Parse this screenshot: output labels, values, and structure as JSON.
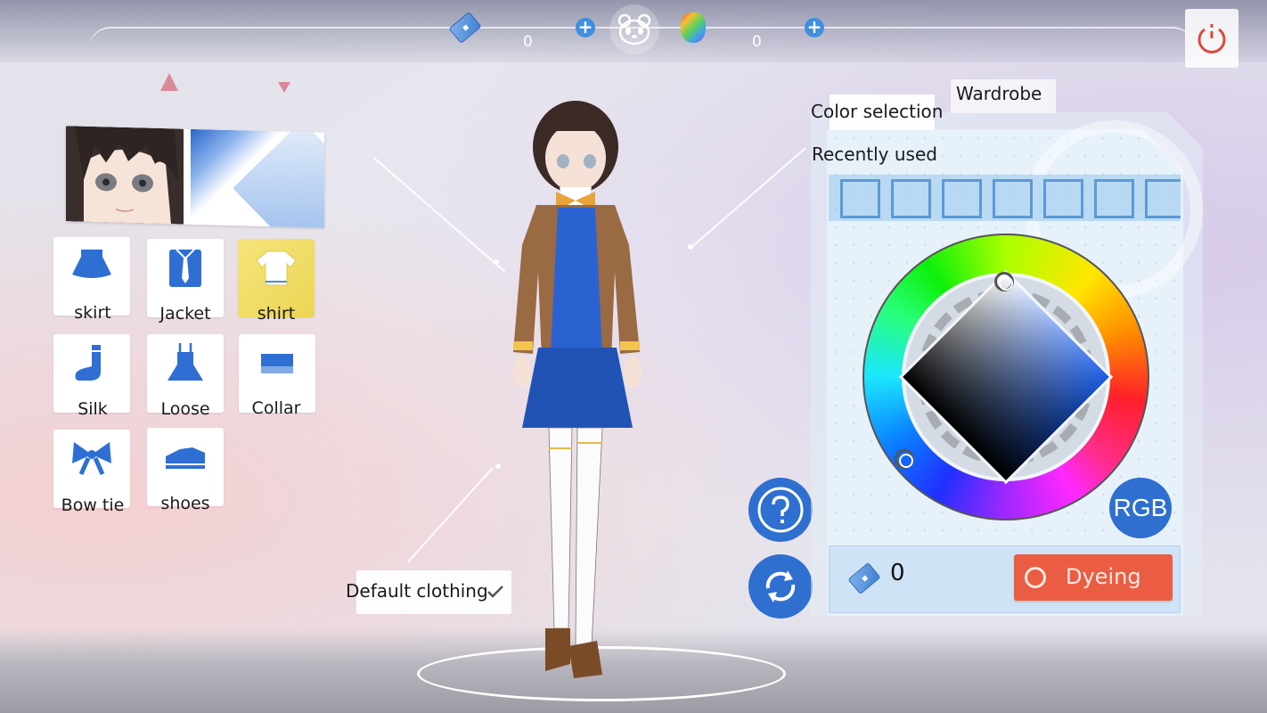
{
  "topbar": {
    "tickets": {
      "icon": "ticket-icon",
      "value": "0",
      "add_icon": "plus-icon"
    },
    "center_icon": "panda-icon",
    "panda_coins": {
      "icon": "rainbow-panda-icon",
      "value": "0",
      "add_icon": "plus-icon"
    },
    "power_icon": "power-icon"
  },
  "left_panel": {
    "avatar_icon": "character-portrait",
    "items": [
      {
        "label": "skirt",
        "icon": "skirt-icon",
        "selected": false
      },
      {
        "label": "Jacket",
        "icon": "jacket-icon",
        "selected": false
      },
      {
        "label": "shirt",
        "icon": "shirt-icon",
        "selected": true
      },
      {
        "label": "Silk",
        "icon": "sock-icon",
        "selected": false
      },
      {
        "label": "Loose",
        "icon": "dress-icon",
        "selected": false
      },
      {
        "label": "Collar",
        "icon": "collar-icon",
        "selected": false
      },
      {
        "label": "Bow tie",
        "icon": "bow-tie-icon",
        "selected": false
      },
      {
        "label": "shoes",
        "icon": "shoe-icon",
        "selected": false
      }
    ]
  },
  "center": {
    "default_clothing_label": "Default clothing",
    "help_icon": "question-icon",
    "refresh_icon": "refresh-icon"
  },
  "color_panel": {
    "tabs": [
      {
        "label": "Color selection",
        "active": true
      },
      {
        "label": "Wardrobe",
        "active": false
      }
    ],
    "recently_used_label": "Recently used",
    "recent_swatches": [
      "",
      "",
      "",
      "",
      "",
      "",
      ""
    ],
    "rgb_label": "RGB",
    "dye_cost": "0",
    "dye_button_label": "Dyeing",
    "colors": {
      "accent_blue": "#2e6fd0",
      "dye_orange": "#ea5d43",
      "selected_yellow": "#f0dc5e"
    }
  }
}
